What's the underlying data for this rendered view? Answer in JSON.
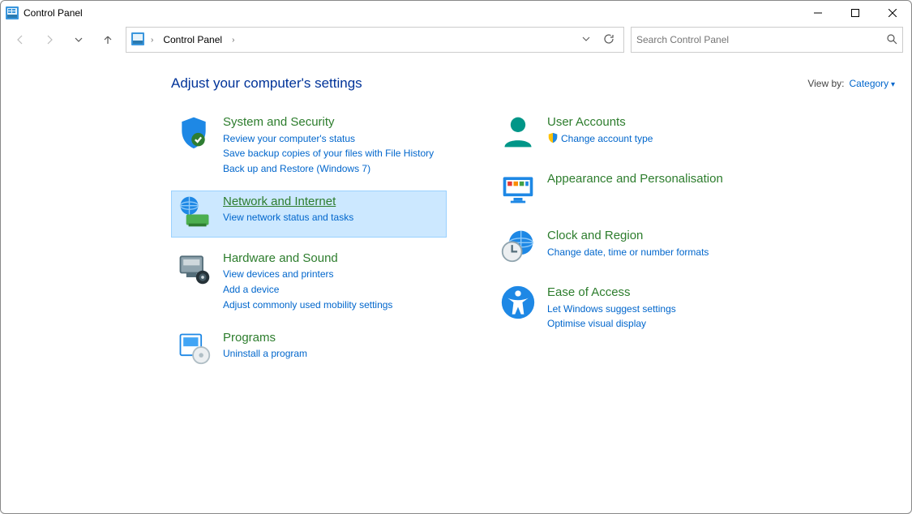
{
  "window": {
    "title": "Control Panel"
  },
  "address": {
    "root": "Control Panel"
  },
  "search": {
    "placeholder": "Search Control Panel"
  },
  "header": {
    "title": "Adjust your computer's settings",
    "viewby_label": "View by:",
    "viewby_value": "Category"
  },
  "left": [
    {
      "title": "System and Security",
      "links": [
        "Review your computer's status",
        "Save backup copies of your files with File History",
        "Back up and Restore (Windows 7)"
      ]
    },
    {
      "title": "Network and Internet",
      "links": [
        "View network status and tasks"
      ],
      "hovered": true
    },
    {
      "title": "Hardware and Sound",
      "links": [
        "View devices and printers",
        "Add a device",
        "Adjust commonly used mobility settings"
      ]
    },
    {
      "title": "Programs",
      "links": [
        "Uninstall a program"
      ]
    }
  ],
  "right": [
    {
      "title": "User Accounts",
      "links": [
        "Change account type"
      ],
      "shield": [
        0
      ]
    },
    {
      "title": "Appearance and Personalisation",
      "links": []
    },
    {
      "title": "Clock and Region",
      "links": [
        "Change date, time or number formats"
      ]
    },
    {
      "title": "Ease of Access",
      "links": [
        "Let Windows suggest settings",
        "Optimise visual display"
      ]
    }
  ]
}
